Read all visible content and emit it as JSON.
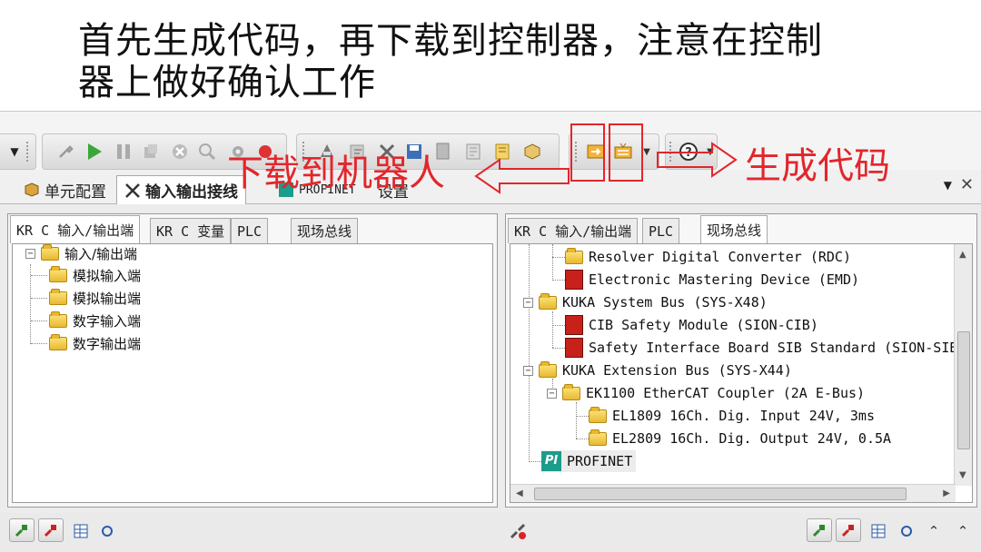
{
  "headline": {
    "line1": "首先生成代码，再下载到控制器，注意在控制",
    "line2": "器上做好确认工作"
  },
  "annotations": {
    "download_label": "下载到机器人",
    "generate_label": "生成代码",
    "color": "#e2262c"
  },
  "toolbar": {
    "icons": [
      "dropdown-icon",
      "wrench-icon",
      "play-icon",
      "pause-icon",
      "stop-icon",
      "cancel-icon",
      "magnifier-icon",
      "gear-icon",
      "record-icon",
      "transfer-icon",
      "edit-icon",
      "tools-icon",
      "save-icon",
      "document-icon",
      "notes-icon",
      "cube-icon",
      "download-icon",
      "generate-code-icon",
      "help-icon"
    ]
  },
  "main_tabs": [
    {
      "label": "单元配置"
    },
    {
      "label": "输入输出接线"
    },
    {
      "label": "PROFINET"
    },
    {
      "label": "设置"
    }
  ],
  "left_panel": {
    "tabs": [
      {
        "label": "KR C 输入/输出端"
      },
      {
        "label": "KR C 变量"
      },
      {
        "label": "PLC"
      },
      {
        "label": "现场总线"
      }
    ],
    "tree": {
      "root": "输入/输出端",
      "children": [
        "模拟输入端",
        "模拟输出端",
        "数字输入端",
        "数字输出端"
      ]
    }
  },
  "right_panel": {
    "tabs": [
      {
        "label": "KR C 输入/输出端"
      },
      {
        "label": "PLC"
      },
      {
        "label": "现场总线"
      }
    ],
    "tree": [
      {
        "label": "Resolver Digital Converter (RDC)",
        "icon": "folder"
      },
      {
        "label": "Electronic Mastering Device (EMD)",
        "icon": "device"
      },
      {
        "label": "KUKA System Bus (SYS-X48)",
        "icon": "folder"
      },
      {
        "label": "CIB Safety Module (SION-CIB)",
        "icon": "device"
      },
      {
        "label": "Safety Interface Board SIB Standard (SION-SIB-STD",
        "icon": "device"
      },
      {
        "label": "KUKA Extension Bus (SYS-X44)",
        "icon": "folder"
      },
      {
        "label": "EK1100 EtherCAT Coupler (2A E-Bus)",
        "icon": "folder"
      },
      {
        "label": "EL1809 16Ch. Dig. Input 24V, 3ms",
        "icon": "folder"
      },
      {
        "label": "EL2809 16Ch. Dig. Output 24V, 0.5A",
        "icon": "folder"
      },
      {
        "label": "PROFINET",
        "icon": "profinet"
      }
    ],
    "profinet_badge": "PI"
  },
  "bottom_bar": {
    "left_icons": [
      "connect-icon",
      "disconnect-icon",
      "edit-table-icon",
      "filter-search-icon"
    ],
    "center_icon": "unlink-icon",
    "right_icons": [
      "connect-icon",
      "disconnect-icon",
      "edit-table-icon",
      "filter-search-icon",
      "collapse-up-icon",
      "expand-up-icon"
    ]
  }
}
